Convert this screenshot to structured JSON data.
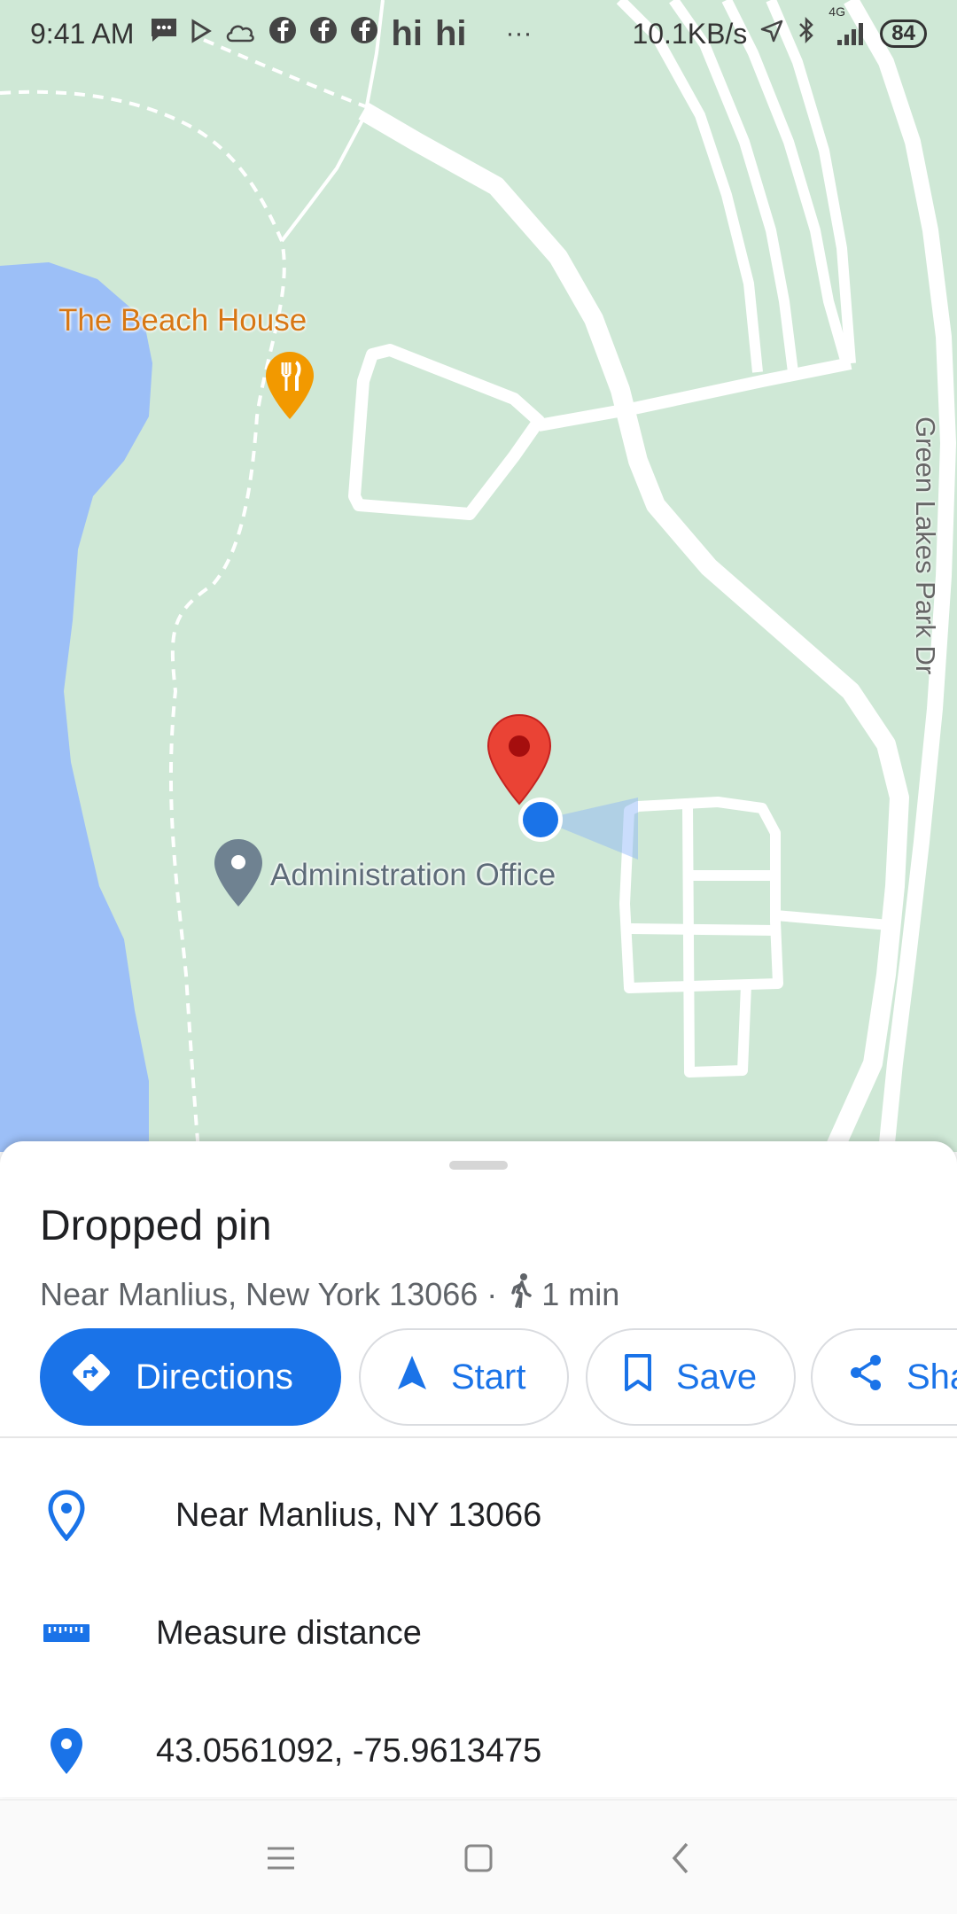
{
  "status_bar": {
    "time": "9:41 AM",
    "hi_1": "hi",
    "hi_2": "hi",
    "more": "···",
    "net_speed": "10.1KB/s",
    "network": "4G",
    "battery": "84"
  },
  "map": {
    "poi_beach_house": "The Beach House",
    "poi_admin_office": "Administration Office",
    "road_name": "Green Lakes Park Dr",
    "colors": {
      "land": "#cfe8d6",
      "water": "#9cbff7",
      "road": "#ffffff",
      "pin_red": "#ea4335",
      "location_blue": "#1a73e8",
      "restaurant_orange": "#f29900",
      "admin_pin_gray": "#6f8291"
    }
  },
  "place": {
    "title": "Dropped pin",
    "location": "Near Manlius, New York 13066",
    "separator": "·",
    "walk_time": "1 min",
    "walk_icon": "walking-person-icon"
  },
  "actions": [
    {
      "label": "Directions",
      "icon": "directions-icon"
    },
    {
      "label": "Start",
      "icon": "navigation-arrow-icon"
    },
    {
      "label": "Save",
      "icon": "bookmark-icon"
    },
    {
      "label": "Sha",
      "icon": "share-icon"
    }
  ],
  "details": {
    "address": "Near Manlius, NY 13066",
    "measure": "Measure distance",
    "coordinates": "43.0561092, -75.9613475"
  },
  "nav": {
    "menu_icon": "menu-icon",
    "home_icon": "home-square-icon",
    "back_icon": "back-chevron-icon"
  }
}
